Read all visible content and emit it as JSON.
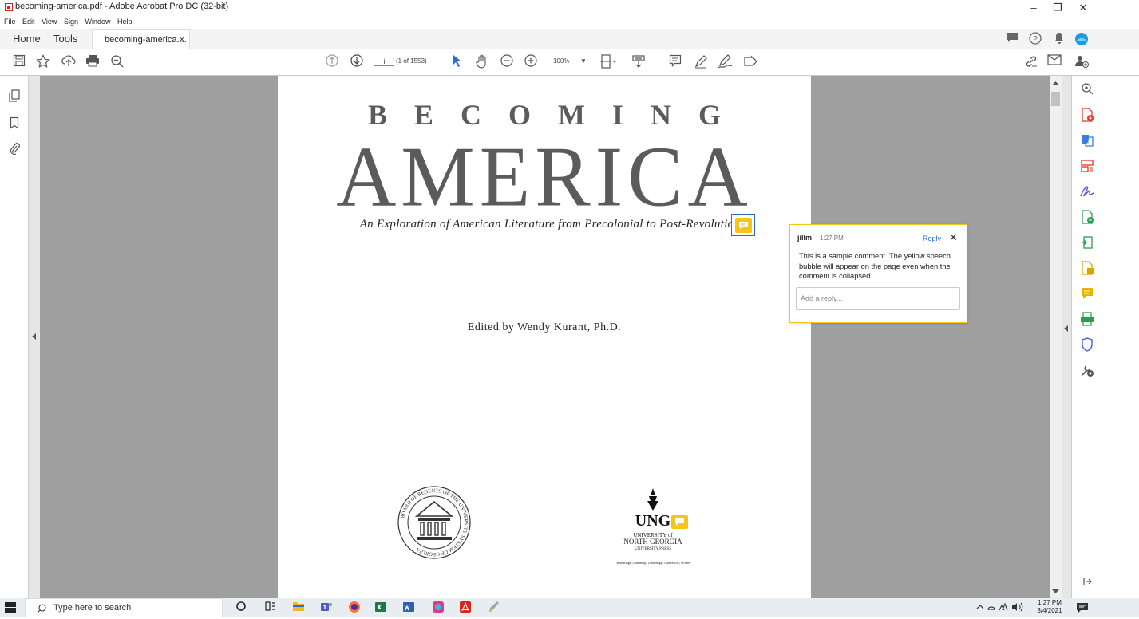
{
  "window": {
    "title": "becoming-america.pdf - Adobe Acrobat Pro DC (32-bit)",
    "minimize": "–",
    "maximize": "❐",
    "close": "✕"
  },
  "menu": [
    "File",
    "Edit",
    "View",
    "Sign",
    "Window",
    "Help"
  ],
  "tabs": {
    "home": "Home",
    "tools": "Tools",
    "document": "becoming-america....",
    "document_close": "×"
  },
  "toolbar": {
    "page_number": "i",
    "page_count": "(1 of 1553)",
    "zoom": "100%"
  },
  "page": {
    "line1": "BECOMING",
    "line2": "AMERICA",
    "subtitle": "An Exploration of American Literature from Precolonial to Post-Revolution",
    "editor": "Edited by Wendy Kurant, Ph.D."
  },
  "comment": {
    "author": "jillm",
    "time": "1:27 PM",
    "reply_label": "Reply",
    "body": "This is a sample comment. The yellow speech bubble will appear on the page even when the comment is collapsed.",
    "reply_placeholder": "Add a reply..."
  },
  "logos": {
    "seal_text": "BOARD OF REGENTS OF THE UNIVERSITY SYSTEM OF GEORGIA",
    "ung": "UNG",
    "ung_line1": "UNIVERSITY of",
    "ung_line2": "NORTH GEORGIA",
    "ung_line3": "UNIVERSITY PRESS",
    "ung_line4": "Blue Ridge | Cumming | Dahlonega | Gainesville | Oconee"
  },
  "taskbar": {
    "search_placeholder": "Type here to search",
    "time": "1:27 PM",
    "date": "3/4/2021"
  },
  "colors": {
    "accent": "#f5c518",
    "link": "#2a6dd6",
    "acrobat_red": "#d9261c",
    "canvas": "#9f9f9f"
  }
}
